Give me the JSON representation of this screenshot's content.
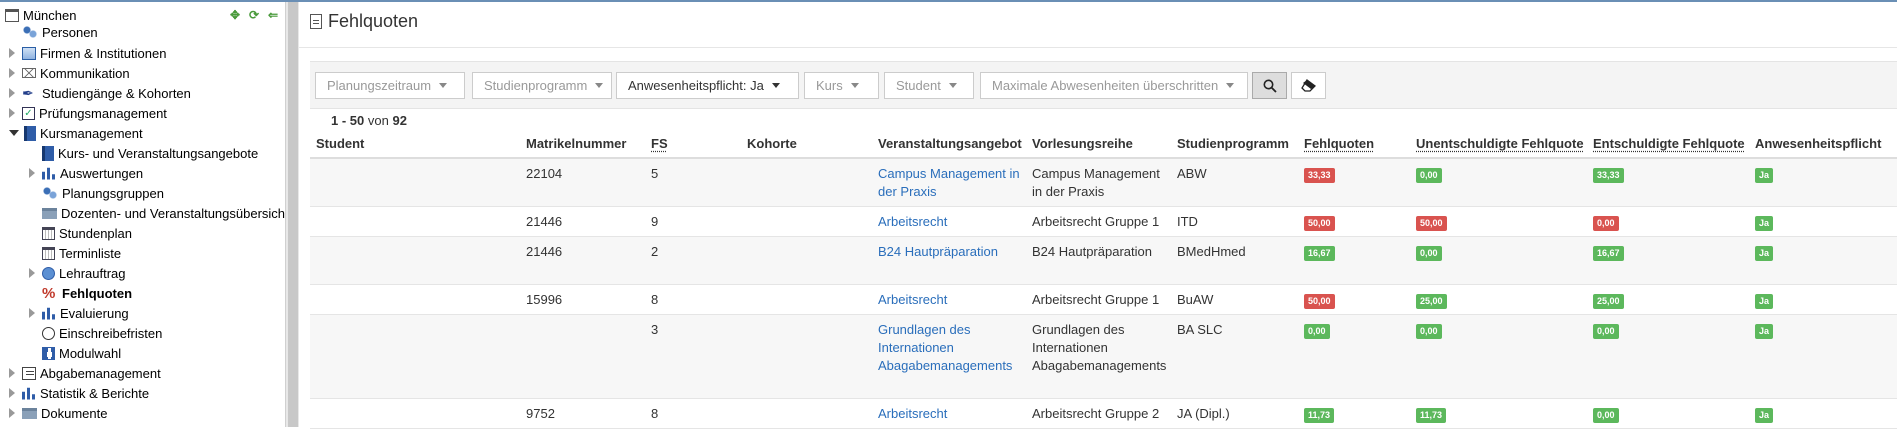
{
  "sidebar": {
    "root": "München",
    "items": [
      {
        "label": "Personen"
      },
      {
        "label": "Firmen & Institutionen"
      },
      {
        "label": "Kommunikation"
      },
      {
        "label": "Studiengänge & Kohorten"
      },
      {
        "label": "Prüfungsmanagement"
      },
      {
        "label": "Kursmanagement"
      },
      {
        "label": "Kurs- und Veranstaltungsangebote"
      },
      {
        "label": "Auswertungen"
      },
      {
        "label": "Planungsgruppen"
      },
      {
        "label": "Dozenten- und Veranstaltungsübersicht"
      },
      {
        "label": "Stundenplan"
      },
      {
        "label": "Terminliste"
      },
      {
        "label": "Lehrauftrag"
      },
      {
        "label": "Fehlquoten"
      },
      {
        "label": "Evaluierung"
      },
      {
        "label": "Einschreibefristen"
      },
      {
        "label": "Modulwahl"
      },
      {
        "label": "Abgabemanagement"
      },
      {
        "label": "Statistik & Berichte"
      },
      {
        "label": "Dokumente"
      }
    ],
    "tools": [
      "collapse-all-icon",
      "refresh-icon",
      "back-arrow-icon"
    ]
  },
  "page": {
    "title": "Fehlquoten"
  },
  "filters": {
    "planungszeitraum": "Planungszeitraum",
    "studienprogramm": "Studienprogramm",
    "anwesenheitspflicht": "Anwesenheitspflicht: Ja",
    "kurs": "Kurs",
    "student": "Student",
    "max_abwesenheiten": "Maximale Abwesenheiten überschritten"
  },
  "pagination": {
    "range": "1 - 50",
    "of": "von",
    "total": "92"
  },
  "table": {
    "headers": {
      "student": "Student",
      "matrikelnummer": "Matrikelnummer",
      "fs": "FS",
      "kohorte": "Kohorte",
      "veranstaltungsangebot": "Veranstaltungsangebot",
      "vorlesungsreihe": "Vorlesungsreihe",
      "studienprogramm": "Studienprogramm",
      "fehlquoten": "Fehlquoten",
      "unentschuldigte": "Unentschuldigte Fehlquote",
      "entschuldigte": "Entschuldigte Fehlquote",
      "anwesenheitspflicht": "Anwesenheitspflicht"
    },
    "rows": [
      {
        "matrikel": "22104",
        "fs": "5",
        "angebot": "Campus Management in der Praxis",
        "reihe": "Campus Management in der Praxis",
        "programm": "ABW",
        "fehl": "33,33",
        "unent": "0,00",
        "ent": "33,33",
        "pflicht": "Ja",
        "fehl_color": "red",
        "unent_color": "green",
        "ent_color": "green"
      },
      {
        "matrikel": "21446",
        "fs": "9",
        "angebot": "Arbeitsrecht",
        "reihe": "Arbeitsrecht Gruppe 1",
        "programm": "ITD",
        "fehl": "50,00",
        "unent": "50,00",
        "ent": "0,00",
        "pflicht": "Ja",
        "fehl_color": "red",
        "unent_color": "red",
        "ent_color": "red"
      },
      {
        "matrikel": "21446",
        "fs": "2",
        "angebot": "B24 Hautpräparation",
        "reihe": "B24 Hautpräparation",
        "programm": "BMedHmed",
        "fehl": "16,67",
        "unent": "0,00",
        "ent": "16,67",
        "pflicht": "Ja",
        "fehl_color": "green",
        "unent_color": "green",
        "ent_color": "green"
      },
      {
        "matrikel": "15996",
        "fs": "8",
        "angebot": "Arbeitsrecht",
        "reihe": "Arbeitsrecht Gruppe 1",
        "programm": "BuAW",
        "fehl": "50,00",
        "unent": "25,00",
        "ent": "25,00",
        "pflicht": "Ja",
        "fehl_color": "red",
        "unent_color": "green",
        "ent_color": "green"
      },
      {
        "matrikel": "",
        "fs": "3",
        "angebot": "Grundlagen des Internationen Abagabemanagements",
        "reihe": "Grundlagen des Internationen Abagabemanagements",
        "programm": "BA SLC",
        "fehl": "0,00",
        "unent": "0,00",
        "ent": "0,00",
        "pflicht": "Ja",
        "fehl_color": "green",
        "unent_color": "green",
        "ent_color": "green"
      },
      {
        "matrikel": "9752",
        "fs": "8",
        "angebot": "Arbeitsrecht",
        "reihe": "Arbeitsrecht Gruppe 2",
        "programm": "JA (Dipl.)",
        "fehl": "11,73",
        "unent": "11,73",
        "ent": "0,00",
        "pflicht": "Ja",
        "fehl_color": "green",
        "unent_color": "green",
        "ent_color": "green"
      }
    ]
  },
  "colors": {
    "link": "#2a6ebb",
    "badge_red": "#d9534f",
    "badge_green": "#5cb85c"
  }
}
